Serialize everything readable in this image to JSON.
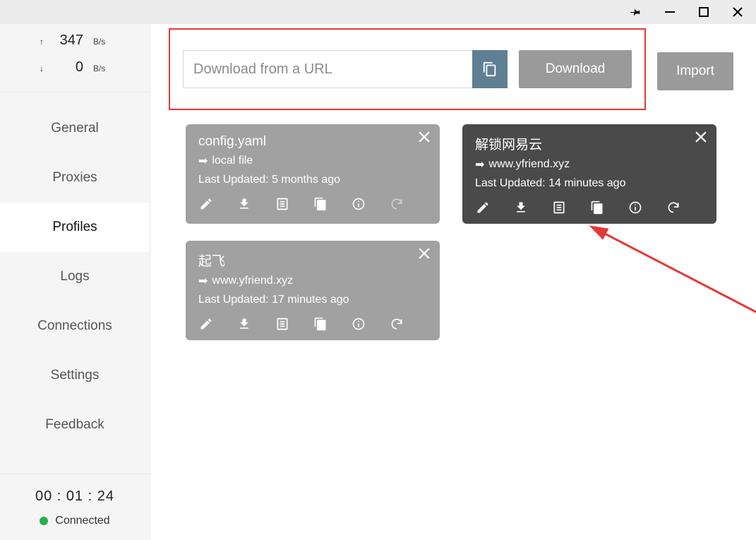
{
  "window": {
    "title": ""
  },
  "speed": {
    "up_value": "347",
    "up_unit": "B/s",
    "down_value": "0",
    "down_unit": "B/s"
  },
  "nav": {
    "items": [
      "General",
      "Proxies",
      "Profiles",
      "Logs",
      "Connections",
      "Settings",
      "Feedback"
    ],
    "active_index": 2
  },
  "status": {
    "timer": "00 : 01 : 24",
    "label": "Connected"
  },
  "urlbar": {
    "placeholder": "Download from a URL",
    "download_label": "Download",
    "import_label": "Import"
  },
  "profiles": [
    {
      "title": "config.yaml",
      "source": "local file",
      "updated_label": "Last Updated: 5 months ago",
      "variant": "gray",
      "refresh_dim": true
    },
    {
      "title": "解锁网易云",
      "source": "www.yfriend.xyz",
      "updated_label": "Last Updated: 14 minutes ago",
      "variant": "dark",
      "refresh_dim": false
    },
    {
      "title": "起飞",
      "source": "www.yfriend.xyz",
      "updated_label": "Last Updated: 17 minutes ago",
      "variant": "gray",
      "refresh_dim": false
    }
  ]
}
